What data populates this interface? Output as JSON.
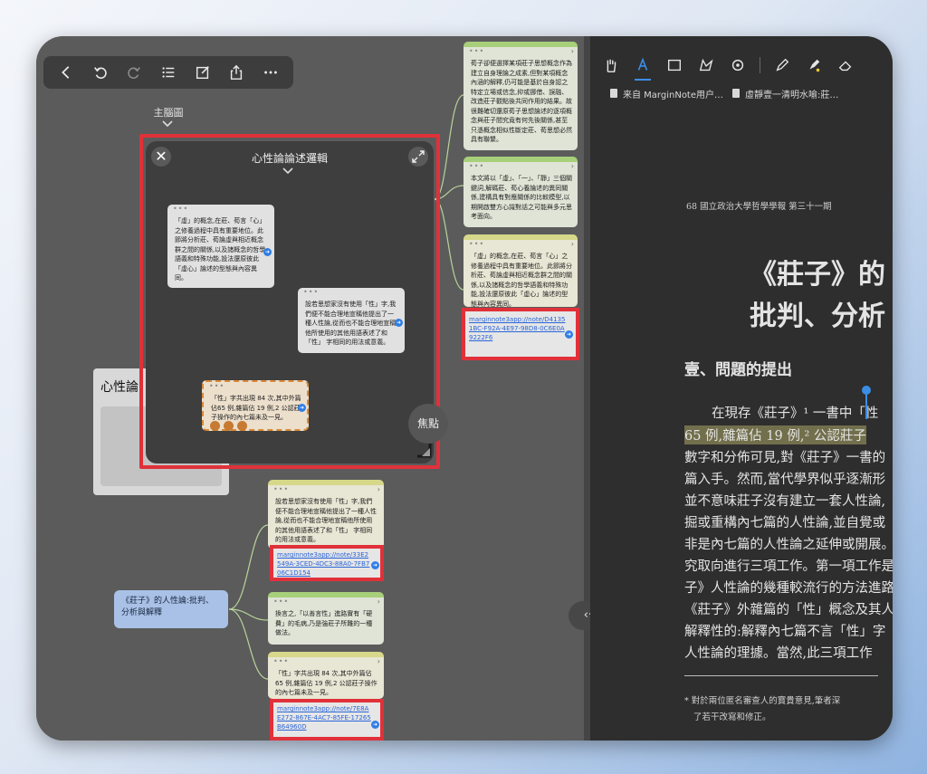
{
  "left_toolbar": {
    "icons": [
      "back-icon",
      "undo-icon",
      "redo-icon",
      "list-icon",
      "edit-icon",
      "share-icon",
      "more-icon"
    ]
  },
  "mindmap": {
    "main_map_label": "主腦圖",
    "panel": {
      "title": "心性論論述邏輯",
      "focus_label": "焦點",
      "close_glyph": "✕"
    },
    "panel_cards": [
      {
        "text": "「虛」的概念,在莊、荀言「心」之修養過程中具有重要地位。此節將分析莊、荀論虛與相近概念群之間的關係,以及諸概念的哲學語義和特殊功能,設法還原彼此「虛心」論述的型態與內容異同。"
      },
      {
        "text": "設若思想家沒有使用「性」字,我們便不能合理地宣稱他提出了一種人性論,從而也不能合理地宣稱他所使用的其他用語表述了和「性」 字相同的用法或意義。"
      },
      {
        "text": "「性」字共出現 84 次,其中外篇佔65 例,雜篇佔 19 例,2 公認莊子操作的內七篇未及一見。"
      }
    ],
    "background_node_title": "心性論",
    "root_node": "《莊子》的人性論:批判、分析與解釋",
    "top_cards": [
      {
        "text": "荀子卻便選擇某項莊子思想概念作為建立自身理論之成素,但對某項概念內涵的解釋,仍可能是基於自身認之特定立場或信念,抑或挪借、誤融、改造莊子觀點後共同作用的結果。故很難確切還原荀子思想論述的逐項概念與莊子間究竟有何先後關係,甚至只憑概念相似性斷定莊、荀思想必然具有聯繫。"
      },
      {
        "text": "本文將以「虛」、「一」、「靜」三個關鍵詞,解碼莊、荀心養論述的異同關係,建構具有對應關係的比較模型,以期開啟雙方心識對話之可能與多元思考面向。"
      },
      {
        "text": "「虛」的概念,在莊、荀言「心」之修養過程中具有重要地位。此節將分析莊、荀論虛與相近概念群之間的關係,以及諸概念的哲學語義和特殊功能,設法還原彼此「虛心」論述的型態與內容異同。",
        "link": "marginnote3app://note/D41351BC-F92A-4E97-98D8-0C6E0A9222F6"
      }
    ],
    "bottom_cards": [
      {
        "text": "設若思想家沒有使用「性」字,我們便不能合理地宣稱他提出了一種人性論,從而也不能合理地宣稱他所使用的其他用語表述了和「性」 字相同的用法或意義。",
        "link": "marginnote3app://note/33E2549A-3CED-4DC3-88A0-7FB706C1D154"
      },
      {
        "text": "換言之,「以善言性」進路實有「硬費」的毛病,乃是強莊子所難的一種做法。"
      },
      {
        "text": "「性」字共出現 84 次,其中外篇佔65 例,雜篇佔 19 例,2 公認莊子操作的內七篇未及一見。",
        "link": "marginnote3app://note/7E8AE272-867E-4AC7-85FE-17265B64960D"
      }
    ]
  },
  "nav_pill_label": "‹·›",
  "reader": {
    "toolbar_icons": [
      "hand-icon",
      "text-highlight-icon",
      "rect-select-icon",
      "lasso-icon",
      "shape-settings-icon",
      "pen-icon",
      "marker-icon",
      "eraser-icon"
    ],
    "tabs": [
      "来自 MarginNote用户…",
      "虛靜壹一清明水喻:莊…"
    ],
    "journal_header": "68  國立政治大學哲學學報  第三十一期",
    "title_line1": "《莊子》的",
    "title_line2": "批判、分析",
    "section_heading": "壹、問題的提出",
    "paragraph_lines": [
      "在現存《莊子》¹ 一書中「性",
      "65 例,雜篇佔 19 例,² 公認莊子",
      "數字和分佈可見,對《莊子》一書的",
      "篇入手。然而,當代學界似乎逐漸形",
      "並不意味莊子沒有建立一套人性論,",
      "掘或重構內七篇的人性論,並自覺或",
      "非是內七篇的人性論之延伸或開展。",
      "究取向進行三項工作。第一項工作是",
      "子》人性論的幾種較流行的方法進路",
      "《莊子》外雜篇的「性」概念及其人",
      "解釋性的:解釋內七篇不言「性」字",
      "人性論的理據。當然,此三項工作"
    ],
    "footnote_lines": [
      "* 對於兩位匿名審查人的寶貴意見,筆者深",
      "了若干改寫和修正。"
    ]
  },
  "colors": {
    "highlight": "#e0313a",
    "accent_blue": "#3b8de6",
    "card_green": "#a8cf7a",
    "card_yellow": "#d7d88a",
    "root_node": "#a9c1e6"
  }
}
